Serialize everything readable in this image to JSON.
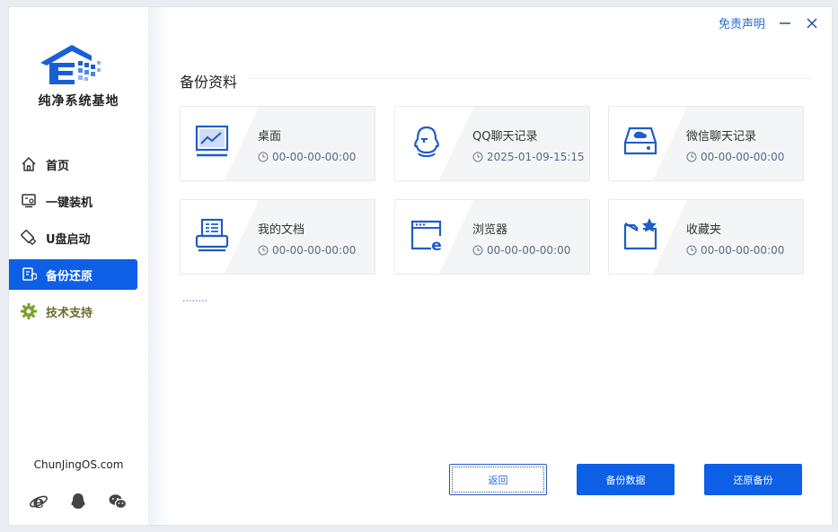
{
  "app": {
    "brand_name": "纯净系统基地",
    "website": "ChunJingOS.com"
  },
  "titlebar": {
    "disclaimer_label": "免责声明",
    "minimize_icon": "minus",
    "close_icon": "x"
  },
  "sidebar": {
    "items": [
      {
        "label": "首页",
        "icon": "home-icon"
      },
      {
        "label": "一键装机",
        "icon": "install-icon"
      },
      {
        "label": "U盘启动",
        "icon": "usb-icon"
      },
      {
        "label": "备份还原",
        "icon": "backup-icon",
        "active": true
      },
      {
        "label": "技术支持",
        "icon": "gear-icon"
      }
    ],
    "social": [
      "ie-icon",
      "qq-icon",
      "wechat-icon"
    ]
  },
  "main": {
    "section_title": "备份资料",
    "cards": [
      {
        "name": "桌面",
        "time": "00-00-00-00:00",
        "icon": "desktop-icon"
      },
      {
        "name": "QQ聊天记录",
        "time": "2025-01-09-15:15",
        "icon": "qq-icon"
      },
      {
        "name": "微信聊天记录",
        "time": "00-00-00-00:00",
        "icon": "disk-icon"
      },
      {
        "name": "我的文档",
        "time": "00-00-00-00:00",
        "icon": "printer-icon"
      },
      {
        "name": "浏览器",
        "time": "00-00-00-00:00",
        "icon": "browser-icon"
      },
      {
        "name": "收藏夹",
        "time": "00-00-00-00:00",
        "icon": "folder-star-icon"
      }
    ],
    "progress_dots": "........"
  },
  "buttons": {
    "back": "返回",
    "backup": "备份数据",
    "restore": "还原备份"
  },
  "colors": {
    "accent": "#0d5fe6",
    "link": "#2a6dd8",
    "support": "#6b6b2d"
  }
}
